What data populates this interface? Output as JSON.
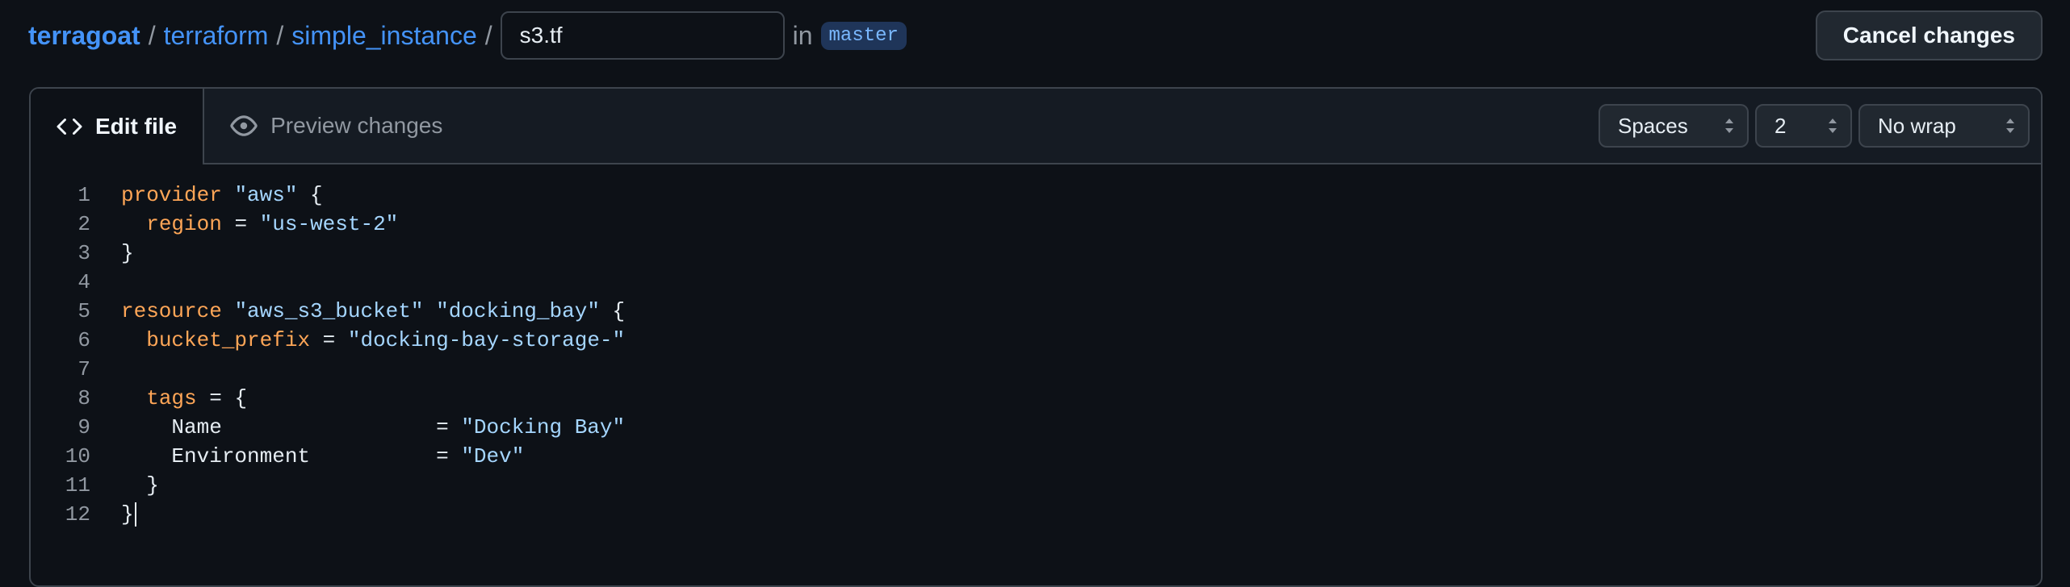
{
  "breadcrumb": {
    "owner": "terragoat",
    "folder1": "terraform",
    "folder2": "simple_instance",
    "separator": "/"
  },
  "filename": {
    "value": "s3.tf"
  },
  "branch": {
    "in_label": "in",
    "name": "master"
  },
  "header": {
    "cancel_label": "Cancel changes"
  },
  "tabs": {
    "edit": "Edit file",
    "preview": "Preview changes"
  },
  "controls": {
    "indent_mode": "Spaces",
    "indent_size": "2",
    "wrap_mode": "No wrap"
  },
  "code": {
    "lines": [
      {
        "n": "1",
        "tokens": [
          {
            "t": "provider",
            "c": "kw"
          },
          {
            "t": " ",
            "c": "src"
          },
          {
            "t": "\"aws\"",
            "c": "str"
          },
          {
            "t": " {",
            "c": "src"
          }
        ]
      },
      {
        "n": "2",
        "tokens": [
          {
            "t": "  ",
            "c": "src"
          },
          {
            "t": "region",
            "c": "kw"
          },
          {
            "t": " = ",
            "c": "src"
          },
          {
            "t": "\"us-west-2\"",
            "c": "str"
          }
        ]
      },
      {
        "n": "3",
        "tokens": [
          {
            "t": "}",
            "c": "src"
          }
        ]
      },
      {
        "n": "4",
        "tokens": []
      },
      {
        "n": "5",
        "tokens": [
          {
            "t": "resource",
            "c": "kw"
          },
          {
            "t": " ",
            "c": "src"
          },
          {
            "t": "\"aws_s3_bucket\"",
            "c": "str"
          },
          {
            "t": " ",
            "c": "src"
          },
          {
            "t": "\"docking_bay\"",
            "c": "str"
          },
          {
            "t": " {",
            "c": "src"
          }
        ]
      },
      {
        "n": "6",
        "tokens": [
          {
            "t": "  ",
            "c": "src"
          },
          {
            "t": "bucket_prefix",
            "c": "kw"
          },
          {
            "t": " = ",
            "c": "src"
          },
          {
            "t": "\"docking-bay-storage-\"",
            "c": "str"
          }
        ]
      },
      {
        "n": "7",
        "tokens": []
      },
      {
        "n": "8",
        "tokens": [
          {
            "t": "  ",
            "c": "src"
          },
          {
            "t": "tags",
            "c": "kw"
          },
          {
            "t": " = {",
            "c": "src"
          }
        ]
      },
      {
        "n": "9",
        "tokens": [
          {
            "t": "    Name                 = ",
            "c": "src"
          },
          {
            "t": "\"Docking Bay\"",
            "c": "str"
          }
        ]
      },
      {
        "n": "10",
        "tokens": [
          {
            "t": "    Environment          = ",
            "c": "src"
          },
          {
            "t": "\"Dev\"",
            "c": "str"
          }
        ]
      },
      {
        "n": "11",
        "tokens": [
          {
            "t": "  }",
            "c": "src"
          }
        ]
      },
      {
        "n": "12",
        "tokens": [
          {
            "t": "}",
            "c": "src"
          }
        ],
        "cursor": true
      }
    ]
  },
  "icons": {
    "edit_tab": "code-icon",
    "preview_tab": "eye-icon",
    "select": "chevron-up-down-icon"
  }
}
